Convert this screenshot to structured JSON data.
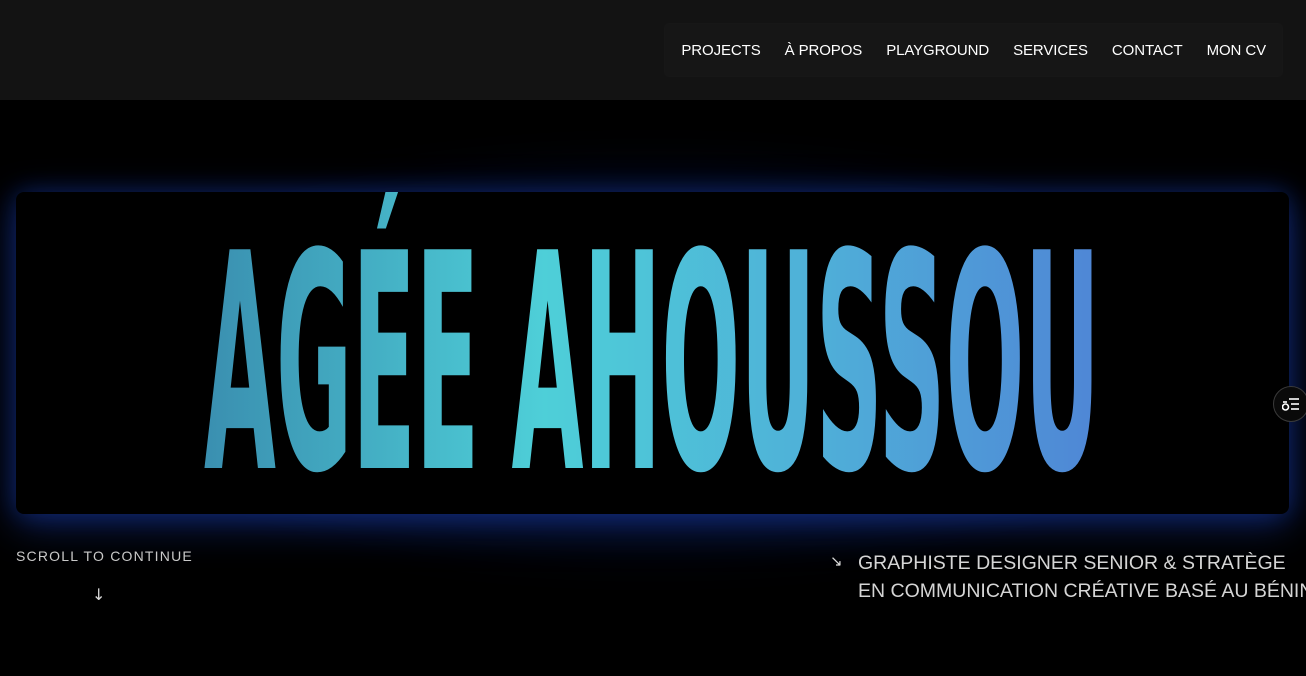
{
  "nav": {
    "items": [
      {
        "label": "PROJECTS"
      },
      {
        "label": "À PROPOS"
      },
      {
        "label": "PLAYGROUND"
      },
      {
        "label": "SERVICES"
      },
      {
        "label": "CONTACT"
      },
      {
        "label": "MON CV"
      }
    ]
  },
  "hero": {
    "title": "AGÉE AHOUSSOU",
    "gradient_colors": [
      "#3a8fb0",
      "#4ecfd8",
      "#4fb0d8",
      "#4f86d6"
    ]
  },
  "scroll": {
    "label": "SCROLL TO CONTINUE",
    "arrow": "↓"
  },
  "tagline": {
    "arrow": "↘",
    "line1": "GRAPHISTE DESIGNER SENIOR & STRATÈGE",
    "line2": "EN COMMUNICATION CRÉATIVE BASÉ AU BÉNIN"
  },
  "side_button": {
    "icon": "settings-sliders-icon"
  },
  "colors": {
    "header_bg": "#131313",
    "page_bg": "#000000",
    "glow": "#1e46b4"
  }
}
